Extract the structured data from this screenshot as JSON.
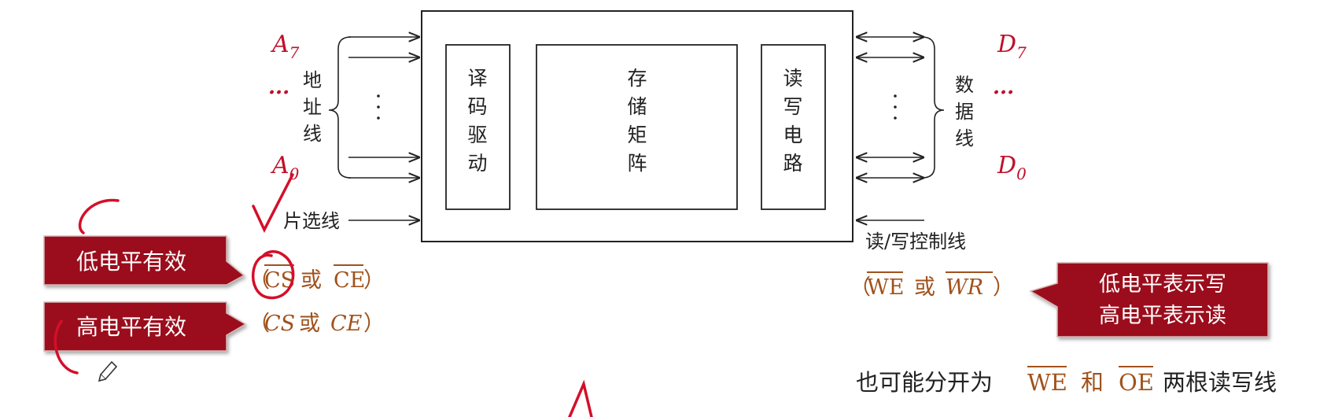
{
  "blocks": {
    "decoder": "译码驱动",
    "storage": "存储矩阵",
    "rw_circuit": "读写电路"
  },
  "address": {
    "top": "A",
    "top_sub": "7",
    "bottom": "A",
    "bottom_sub": "0",
    "ellipsis": "···",
    "label": "地址线"
  },
  "data_lines": {
    "top": "D",
    "top_sub": "7",
    "bottom": "D",
    "bottom_sub": "0",
    "ellipsis": "···",
    "label": "数据线"
  },
  "chip_select": {
    "label": "片选线",
    "low_form": "（CS或 CE）",
    "low_cs": "CS",
    "low_or": "或",
    "low_ce": "CE",
    "high_form": "（CS或 CE）",
    "high_cs": "CS",
    "high_or": "或",
    "high_ce": "CE"
  },
  "rw_control": {
    "label": "读/写控制线",
    "we": "WE",
    "or": "或",
    "wr": "WR",
    "open": "（",
    "close": "）"
  },
  "callouts": {
    "low_active": "低电平有效",
    "high_active": "高电平有效",
    "rw_low": "低电平表示写",
    "rw_high": "高电平表示读"
  },
  "note": {
    "prefix": "也可能分开为",
    "we": "WE",
    "and": "和",
    "oe": "OE",
    "suffix": "两根读写线"
  },
  "colors": {
    "accent_red": "#c0102a",
    "callout_bg": "#9b0f1e",
    "brown": "#a0521c"
  }
}
